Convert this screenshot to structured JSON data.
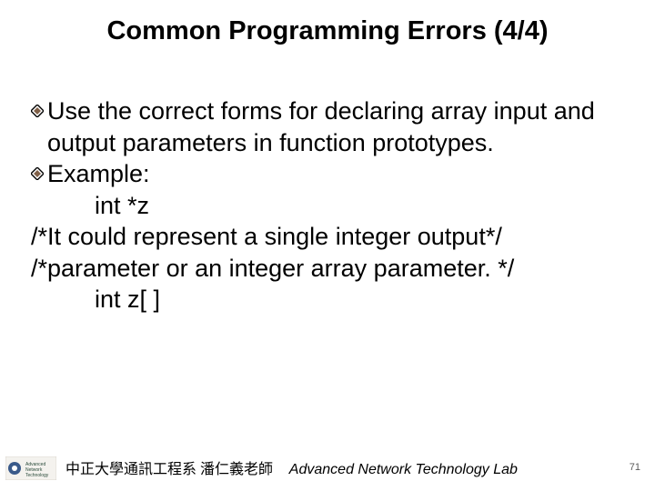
{
  "title": "Common Programming Errors (4/4)",
  "bullets": {
    "b1": "Use the correct forms for declaring array input and output parameters in function prototypes.",
    "b2": "Example:"
  },
  "lines": {
    "l1": "int *z",
    "l2": "/*It could represent a single integer output*/",
    "l3": "/*parameter or an integer array parameter. */",
    "l4": "int z[ ]"
  },
  "footer": {
    "zh": "中正大學通訊工程系 潘仁義老師",
    "en": "Advanced Network Technology Lab"
  },
  "page": "71"
}
